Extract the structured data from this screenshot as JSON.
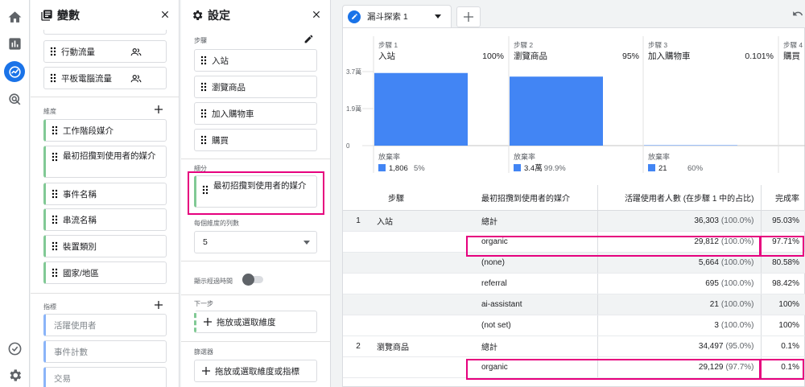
{
  "variables_panel": {
    "title": "變數",
    "segments": [
      "行動流量",
      "平板電腦流量"
    ],
    "dimensions_label": "維度",
    "dimensions": [
      "工作階段媒介",
      "最初招攬到使用者的媒介",
      "事件名稱",
      "串流名稱",
      "裝置類別",
      "國家/地區"
    ],
    "metrics_label": "指標",
    "metrics": [
      "活躍使用者",
      "事件計數",
      "交易"
    ]
  },
  "settings_panel": {
    "title": "設定",
    "steps_label": "步驟",
    "steps": [
      "入站",
      "瀏覽商品",
      "加入購物車",
      "購買"
    ],
    "breakdown_label": "細分",
    "breakdown_value": "最初招攬到使用者的媒介",
    "rows_per_dimension_label": "每個維度的列數",
    "rows_per_dimension_value": "5",
    "show_elapsed_label": "顯示經過時間",
    "next_action_label": "下一步",
    "next_action_placeholder": "拖放或選取維度",
    "filter_label": "篩選器",
    "filter_placeholder": "拖放或選取維度或指標"
  },
  "tab": {
    "label": "漏斗探索 1"
  },
  "colors": {
    "accent": "#1a73e8",
    "bar": "#4285f4",
    "highlight": "#e6007e"
  },
  "chart_data": {
    "type": "bar",
    "y_ticks": [
      "3.7萬",
      "1.9萬",
      "0"
    ],
    "ylim": [
      0,
      37000
    ],
    "steps": [
      {
        "header": "步驟 1",
        "name": "入站",
        "pct": "100%",
        "value": 36303,
        "abandon_label": "放棄率",
        "abandon_count": "1,806",
        "abandon_pct": "5%"
      },
      {
        "header": "步驟 2",
        "name": "瀏覽商品",
        "pct": "95%",
        "value": 34497,
        "abandon_label": "放棄率",
        "abandon_count": "3.4萬",
        "abandon_pct": "99.9%"
      },
      {
        "header": "步驟 3",
        "name": "加入購物車",
        "pct": "0.101%",
        "value": 35,
        "abandon_label": "放棄率",
        "abandon_count": "21",
        "abandon_pct": "60%"
      },
      {
        "header": "步驟 4",
        "name": "購買",
        "pct": "",
        "value": null,
        "abandon_label": "",
        "abandon_count": "",
        "abandon_pct": ""
      }
    ]
  },
  "table": {
    "headers": [
      "步驟",
      "最初招攬到使用者的媒介",
      "活躍使用者人數 (在步驟 1 中的占比)",
      "完成率"
    ],
    "rows": [
      {
        "idx": "1",
        "step": "入站",
        "medium": "總計",
        "users": "36,303",
        "share": "(100.0%)",
        "rate": "95.03%",
        "group": true
      },
      {
        "idx": "",
        "step": "",
        "medium": "organic",
        "users": "29,812",
        "share": "(100.0%)",
        "rate": "97.71%",
        "group": false
      },
      {
        "idx": "",
        "step": "",
        "medium": "(none)",
        "users": "5,664",
        "share": "(100.0%)",
        "rate": "80.58%",
        "group": true
      },
      {
        "idx": "",
        "step": "",
        "medium": "referral",
        "users": "695",
        "share": "(100.0%)",
        "rate": "98.42%",
        "group": false
      },
      {
        "idx": "",
        "step": "",
        "medium": "ai-assistant",
        "users": "21",
        "share": "(100.0%)",
        "rate": "100%",
        "group": true
      },
      {
        "idx": "",
        "step": "",
        "medium": "(not set)",
        "users": "3",
        "share": "(100.0%)",
        "rate": "100%",
        "group": false
      },
      {
        "idx": "2",
        "step": "瀏覽商品",
        "medium": "總計",
        "users": "34,497",
        "share": "(95.0%)",
        "rate": "0.1%",
        "group": false
      },
      {
        "idx": "",
        "step": "",
        "medium": "organic",
        "users": "29,129",
        "share": "(97.7%)",
        "rate": "0.1%",
        "group": false
      }
    ]
  }
}
